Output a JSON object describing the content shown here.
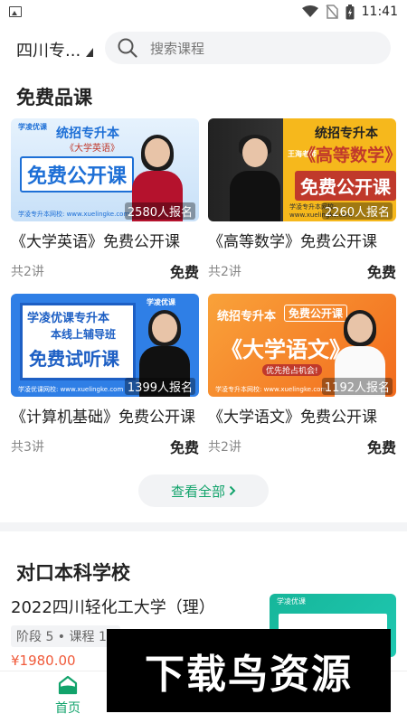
{
  "status_bar": {
    "time": "11:41"
  },
  "header": {
    "location": "四川专...",
    "search_placeholder": "搜索课程"
  },
  "free_section": {
    "title": "免费品课",
    "courses": [
      {
        "title": "《大学英语》免费公开课",
        "lessons": "共2讲",
        "price": "免费",
        "enrolled": "2580人报名",
        "thumb_line1": "统招专升本",
        "thumb_sub": "《大学英语》",
        "thumb_line2": "免费公开课",
        "thumb_brand": "学凌优课",
        "thumb_site": "学凌专升本网校: www.xuelingke.com",
        "bg": "#d9ecfb",
        "accent": "#1d6fd6"
      },
      {
        "title": "《高等数学》免费公开课",
        "lessons": "共2讲",
        "price": "免费",
        "enrolled": "2260人报名",
        "thumb_line1": "统招专升本",
        "thumb_sub": "《高等数学》",
        "thumb_line2": "免费公开课",
        "thumb_brand": "王海老师",
        "thumb_site": "学凌专升本网校: www.xuelingke.com",
        "bg": "#f6b81c",
        "accent": "#c0392b"
      },
      {
        "title": "《计算机基础》免费公开课",
        "lessons": "共3讲",
        "price": "免费",
        "enrolled": "1399人报名",
        "thumb_line1": "学凌优课专升本",
        "thumb_sub": "本线上辅导班",
        "thumb_line2": "免费试听课",
        "thumb_brand": "学凌优课",
        "thumb_site": "学凌优课网校: www.xuelingke.com",
        "bg": "#2f7fe6",
        "accent": "#ffd400"
      },
      {
        "title": "《大学语文》免费公开课",
        "lessons": "共2讲",
        "price": "免费",
        "enrolled": "1192人报名",
        "thumb_line1": "统招专升本",
        "thumb_sub": "免费公开课",
        "thumb_line2": "《大学语文》",
        "thumb_brand": "优先抢占机会!",
        "thumb_site": "学凌专升本网校: www.xuelingke.com",
        "bg": "#f58a1f",
        "accent": "#ffffff"
      }
    ],
    "view_all": "查看全部"
  },
  "school_section": {
    "title": "对口本科学校",
    "school_name": "2022四川轻化工大学（理）",
    "stage": "阶段 5 • 课程 13",
    "price": "¥1980.00",
    "thumb_brand": "学凌优课"
  },
  "tabbar": {
    "home": "首页"
  },
  "watermark": "下载鸟资源"
}
